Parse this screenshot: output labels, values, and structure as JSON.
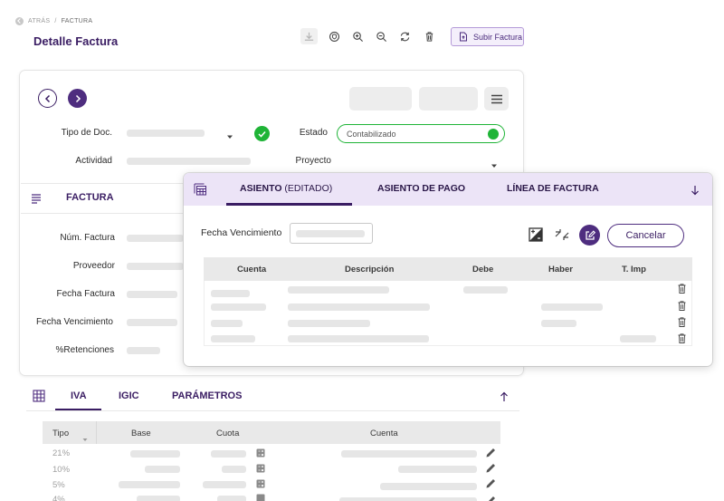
{
  "breadcrumb": {
    "back": "ATRÁS",
    "separator": "/",
    "current": "FACTURA"
  },
  "page_title": "Detalle Factura",
  "toolbar": {
    "icons": [
      "download-icon",
      "shield-icon",
      "zoom-in-icon",
      "zoom-out-icon",
      "rotate-icon",
      "delete-icon"
    ],
    "upload_label": "Subir Factura"
  },
  "form": {
    "tipo_doc_label": "Tipo de Doc.",
    "estado_label": "Estado",
    "estado_value": "Contabilizado",
    "actividad_label": "Actividad",
    "proyecto_label": "Proyecto"
  },
  "section": {
    "title": "FACTURA"
  },
  "factura_fields": {
    "num_factura": "Núm. Factura",
    "proveedor": "Proveedor",
    "fecha_factura": "Fecha Factura",
    "fecha_vencimiento": "Fecha Vencimiento",
    "retenciones": "%Retenciones"
  },
  "panel": {
    "tabs": {
      "asiento": "ASIENTO",
      "asiento_suffix": "(EDITADO)",
      "asiento_pago": "ASIENTO DE PAGO",
      "linea_factura": "LÍNEA DE FACTURA"
    },
    "fecha_vencimiento_label": "Fecha Vencimiento",
    "cancel_label": "Cancelar",
    "columns": {
      "cuenta": "Cuenta",
      "descripcion": "Descripción",
      "debe": "Debe",
      "haber": "Haber",
      "timp": "T. Imp"
    }
  },
  "tax_tabs": {
    "iva": "IVA",
    "igic": "IGIC",
    "parametros": "PARÁMETROS"
  },
  "tax_table": {
    "columns": {
      "tipo": "Tipo",
      "base": "Base",
      "cuota": "Cuota",
      "cuenta": "Cuenta"
    },
    "rows": [
      "21%",
      "10%",
      "5%",
      "4%"
    ]
  },
  "colors": {
    "brand": "#3a1d63",
    "accent": "#4e2d7f",
    "success": "#1fb437",
    "panel_tab_bg": "#ece4f7"
  }
}
